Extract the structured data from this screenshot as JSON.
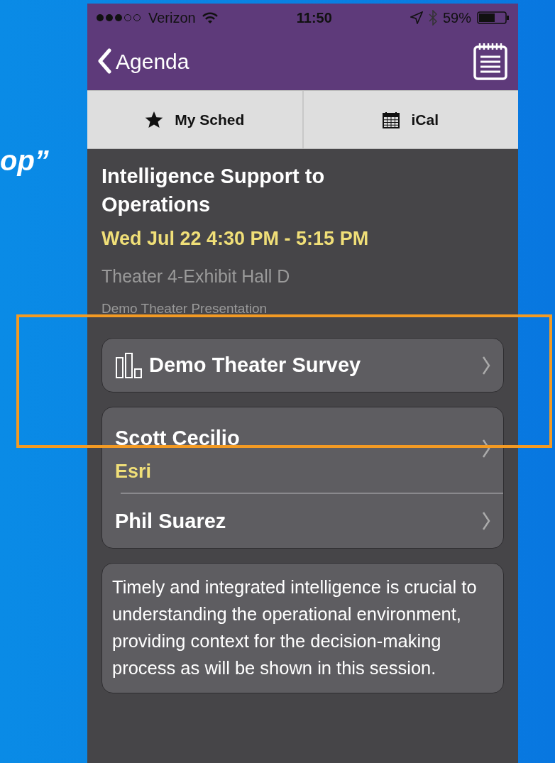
{
  "slide": {
    "heading_fragment": "op”"
  },
  "status_bar": {
    "carrier": "Verizon",
    "time": "11:50",
    "battery": "59%"
  },
  "nav": {
    "back_label": "Agenda"
  },
  "toolbar": [
    {
      "kind": "star",
      "label": "My Sched"
    },
    {
      "kind": "calendar",
      "label": "iCal"
    }
  ],
  "session": {
    "title": "Intelligence Support to Operations",
    "time": "Wed Jul 22 4:30 PM - 5:15 PM",
    "location": "Theater 4-Exhibit Hall D",
    "type": "Demo Theater Presentation"
  },
  "survey": {
    "label": "Demo Theater Survey"
  },
  "speakers": [
    {
      "name": "Scott Cecilio",
      "organization": "Esri"
    },
    {
      "name": "Phil Suarez"
    }
  ],
  "description": "Timely and integrated intelligence is crucial to understanding the operational environment, providing context for the decision-making process as will be shown in this session."
}
